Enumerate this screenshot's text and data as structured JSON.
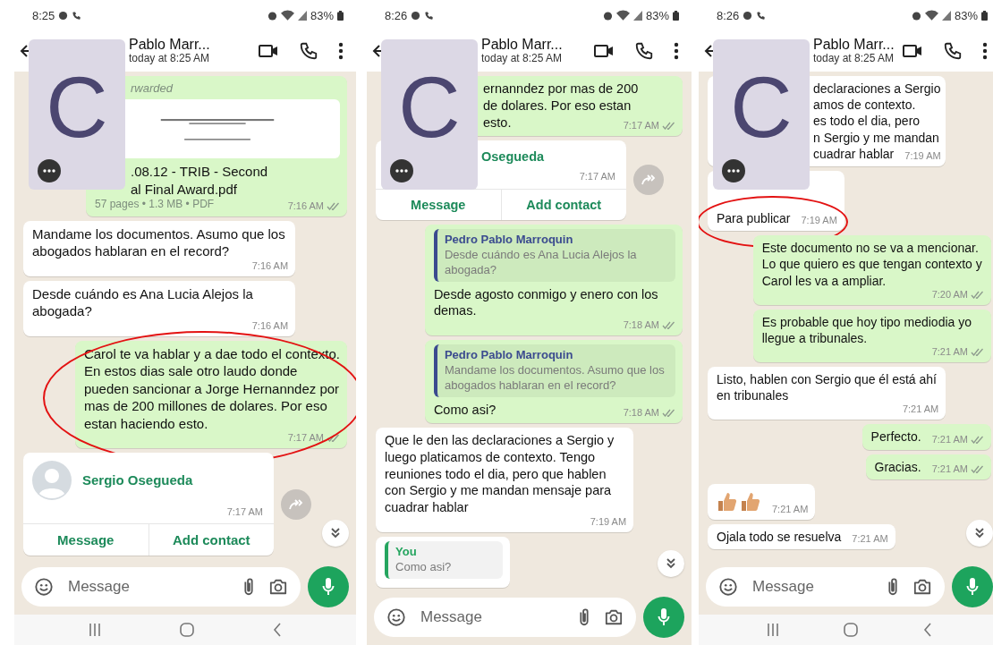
{
  "panels": [
    {
      "status_bar": {
        "time": "8:25",
        "battery": "83%"
      },
      "header": {
        "name": "Pablo Marr...",
        "subtitle": "today at 8:25 AM"
      },
      "overlay_card": {
        "letter": "C"
      },
      "messages": [
        {
          "kind": "document",
          "outgoing": true,
          "covered": true,
          "highlighted": false,
          "label": "rwarded",
          "lines": [
            ".08.12 -  TRIB - Second",
            "al Final Award.pdf"
          ],
          "meta": "57 pages • 1.3 MB • PDF",
          "time": "7:16 AM"
        },
        {
          "kind": "text",
          "outgoing": false,
          "covered": false,
          "highlighted": false,
          "text": "Mandame los documentos. Asumo que los abogados hablaran en el record?",
          "time": "7:16 AM"
        },
        {
          "kind": "text",
          "outgoing": false,
          "covered": false,
          "highlighted": false,
          "text": "Desde cuándo es Ana Lucia Alejos la abogada?",
          "time": "7:16 AM"
        },
        {
          "kind": "text",
          "outgoing": true,
          "covered": false,
          "highlighted": true,
          "text": "Carol te va hablar y a dae todo el contexto. En estos dias sale otro laudo donde pueden sancionar a Jorge Hernanndez por mas de 200 millones de dolares. Por eso estan haciendo esto.",
          "time": "7:17 AM"
        },
        {
          "kind": "contact",
          "outgoing": false,
          "covered": false,
          "highlighted": false,
          "name": "Sergio Osegueda",
          "time": "7:17 AM",
          "actions": [
            "Message",
            "Add contact"
          ]
        }
      ],
      "composer": {
        "placeholder": "Message"
      },
      "navigation_bar": true
    },
    {
      "status_bar": {
        "time": "8:26",
        "battery": "83%"
      },
      "header": {
        "name": "Pablo Marr...",
        "subtitle": "today at 8:25 AM"
      },
      "overlay_card": {
        "letter": "C"
      },
      "messages": [
        {
          "kind": "text",
          "outgoing": true,
          "covered": true,
          "highlighted": false,
          "lines": [
            "ernanndez por mas de 200",
            "de dolares. Por eso estan",
            "esto."
          ],
          "time": "7:17 AM"
        },
        {
          "kind": "contact",
          "outgoing": false,
          "covered": true,
          "highlighted": false,
          "name": "Osegueda",
          "time": "7:17 AM",
          "actions": [
            "Message",
            "Add contact"
          ]
        },
        {
          "kind": "reply",
          "outgoing": true,
          "covered": false,
          "highlighted": false,
          "quote_author": "Pedro Pablo Marroquin",
          "quote_text": "Desde cuándo es Ana Lucia Alejos la abogada?",
          "color": "#3b4b8f",
          "text": "Desde agosto conmigo y enero con los demas.",
          "time": "7:18 AM"
        },
        {
          "kind": "reply",
          "outgoing": true,
          "covered": false,
          "highlighted": false,
          "quote_author": "Pedro Pablo Marroquin",
          "quote_text": "Mandame los documentos. Asumo que los abogados hablaran en el record?",
          "color": "#3b4b8f",
          "text": "Como asi?",
          "time": "7:18 AM"
        },
        {
          "kind": "text",
          "outgoing": false,
          "covered": false,
          "highlighted": false,
          "text": "Que le den las declaraciones a Sergio y luego platicamos de contexto. Tengo reuniones todo el dia, pero que hablen con Sergio y me mandan mensaje para cuadrar hablar",
          "time": "7:19 AM"
        },
        {
          "kind": "reply",
          "outgoing": false,
          "covered": false,
          "highlighted": false,
          "quote_author": "You",
          "quote_text": "Como asi?",
          "color": "#25a55f"
        }
      ],
      "composer": {
        "placeholder": "Message"
      },
      "navigation_bar": false
    },
    {
      "status_bar": {
        "time": "8:26",
        "battery": "83%"
      },
      "header": {
        "name": "Pablo Marr...",
        "subtitle": "today at 8:25 AM"
      },
      "overlay_card": {
        "letter": "C"
      },
      "messages": [
        {
          "kind": "text",
          "outgoing": false,
          "covered": true,
          "highlighted": false,
          "lines": [
            "declaraciones a Sergio",
            "amos de contexto.",
            "es todo el dia, pero",
            "n Sergio y me mandan",
            "cuadrar hablar"
          ],
          "time": "7:19 AM"
        },
        {
          "kind": "reply",
          "outgoing": false,
          "covered": true,
          "highlighted": true,
          "text": "Para publicar",
          "time": "7:19 AM"
        },
        {
          "kind": "text",
          "outgoing": true,
          "covered": false,
          "highlighted": false,
          "text": "Este documento no se va a mencionar. Lo que quiero es que tengan contexto y Carol les va a ampliar.",
          "time": "7:20 AM"
        },
        {
          "kind": "text",
          "outgoing": true,
          "covered": false,
          "highlighted": false,
          "text": "Es probable que hoy tipo mediodia yo llegue a tribunales.",
          "time": "7:21 AM"
        },
        {
          "kind": "text",
          "outgoing": false,
          "covered": false,
          "highlighted": false,
          "text": "Listo, hablen con Sergio que él está ahí en tribunales",
          "time": "7:21 AM"
        },
        {
          "kind": "text",
          "outgoing": true,
          "covered": false,
          "highlighted": false,
          "text": "Perfecto.",
          "time": "7:21 AM"
        },
        {
          "kind": "text",
          "outgoing": true,
          "covered": false,
          "highlighted": false,
          "text": "Gracias.",
          "time": "7:21 AM"
        },
        {
          "kind": "emoji",
          "outgoing": false,
          "covered": false,
          "highlighted": false,
          "time": "7:21 AM"
        },
        {
          "kind": "text",
          "outgoing": false,
          "covered": false,
          "highlighted": false,
          "text": "Ojala todo se resuelva",
          "time": "7:21 AM"
        }
      ],
      "composer": {
        "placeholder": "Message"
      },
      "navigation_bar": true
    }
  ]
}
